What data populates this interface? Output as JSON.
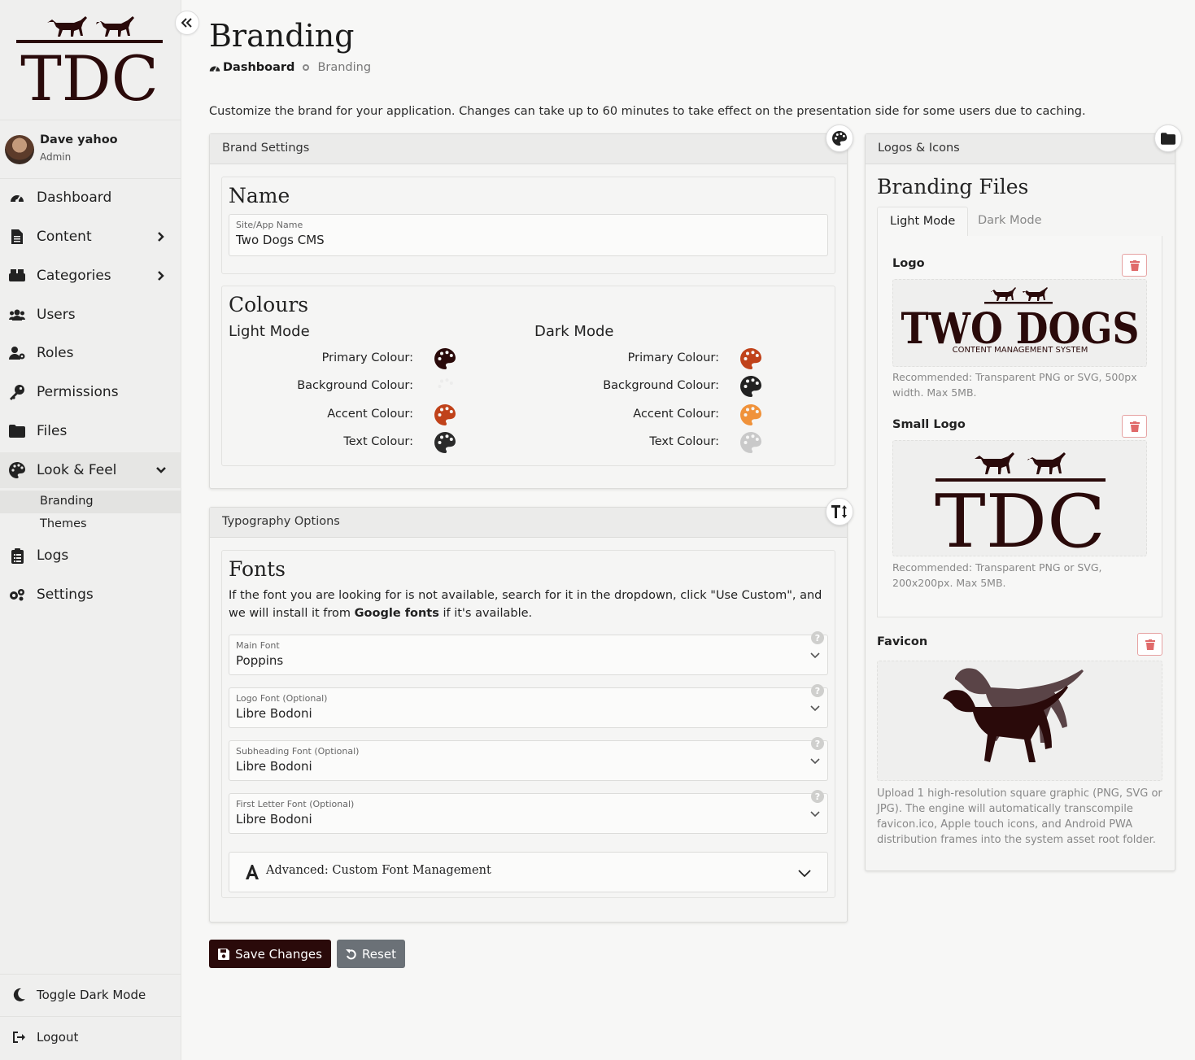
{
  "brand": {
    "logo_text": "TDC"
  },
  "user": {
    "name": "Dave yahoo",
    "role": "Admin"
  },
  "nav": {
    "items": [
      {
        "label": "Dashboard"
      },
      {
        "label": "Content"
      },
      {
        "label": "Categories"
      },
      {
        "label": "Users"
      },
      {
        "label": "Roles"
      },
      {
        "label": "Permissions"
      },
      {
        "label": "Files"
      },
      {
        "label": "Look & Feel"
      },
      {
        "label": "Logs"
      },
      {
        "label": "Settings"
      }
    ],
    "sub_items": [
      {
        "label": "Branding"
      },
      {
        "label": "Themes"
      }
    ],
    "toggle_dark": "Toggle Dark Mode",
    "logout": "Logout"
  },
  "header": {
    "title": "Branding",
    "breadcrumb_home": "Dashboard",
    "breadcrumb_current": "Branding",
    "intro": "Customize the brand for your application. Changes can take up to 60 minutes to take effect on the presentation side for some users due to caching."
  },
  "brand_settings": {
    "card_title": "Brand Settings",
    "name_heading": "Name",
    "site_name_label": "Site/App Name",
    "site_name_value": "Two Dogs CMS",
    "colours_heading": "Colours",
    "light_title": "Light Mode",
    "dark_title": "Dark Mode",
    "rows": [
      "Primary Colour:",
      "Background Colour:",
      "Accent Colour:",
      "Text Colour:"
    ],
    "light_colors": [
      "#2a0a0a",
      "#f5f5f4",
      "#c0421a",
      "#2a2a2a"
    ],
    "dark_colors": [
      "#c0421a",
      "#222222",
      "#f0923a",
      "#c9c9c9"
    ]
  },
  "typography": {
    "card_title": "Typography Options",
    "fonts_heading": "Fonts",
    "desc_part1": "If the font you are looking for is not available, search for it in the dropdown, click \"Use Custom\", and we will install it from ",
    "desc_bold": "Google fonts",
    "desc_part2": " if it's available.",
    "fields": [
      {
        "label": "Main Font",
        "value": "Poppins"
      },
      {
        "label": "Logo Font (Optional)",
        "value": "Libre Bodoni"
      },
      {
        "label": "Subheading Font (Optional)",
        "value": "Libre Bodoni"
      },
      {
        "label": "First Letter Font (Optional)",
        "value": "Libre Bodoni"
      }
    ],
    "advanced_label": "Advanced: Custom Font Management"
  },
  "actions": {
    "save": "Save Changes",
    "reset": "Reset"
  },
  "logos": {
    "card_title": "Logos & Icons",
    "heading": "Branding Files",
    "tab_light": "Light Mode",
    "tab_dark": "Dark Mode",
    "logo_label": "Logo",
    "logo_big_text": "TWO DOGS",
    "logo_sub_text": "CONTENT MANAGEMENT SYSTEM",
    "logo_note": "Recommended: Transparent PNG or SVG, 500px width. Max 5MB.",
    "small_logo_label": "Small Logo",
    "small_logo_text": "TDC",
    "small_logo_note": "Recommended: Transparent PNG or SVG, 200x200px. Max 5MB.",
    "favicon_label": "Favicon",
    "favicon_note": "Upload 1 high-resolution square graphic (PNG, SVG or JPG). The engine will automatically transcompile favicon.ico, Apple touch icons, and Android PWA distribution frames into the system asset root folder."
  }
}
